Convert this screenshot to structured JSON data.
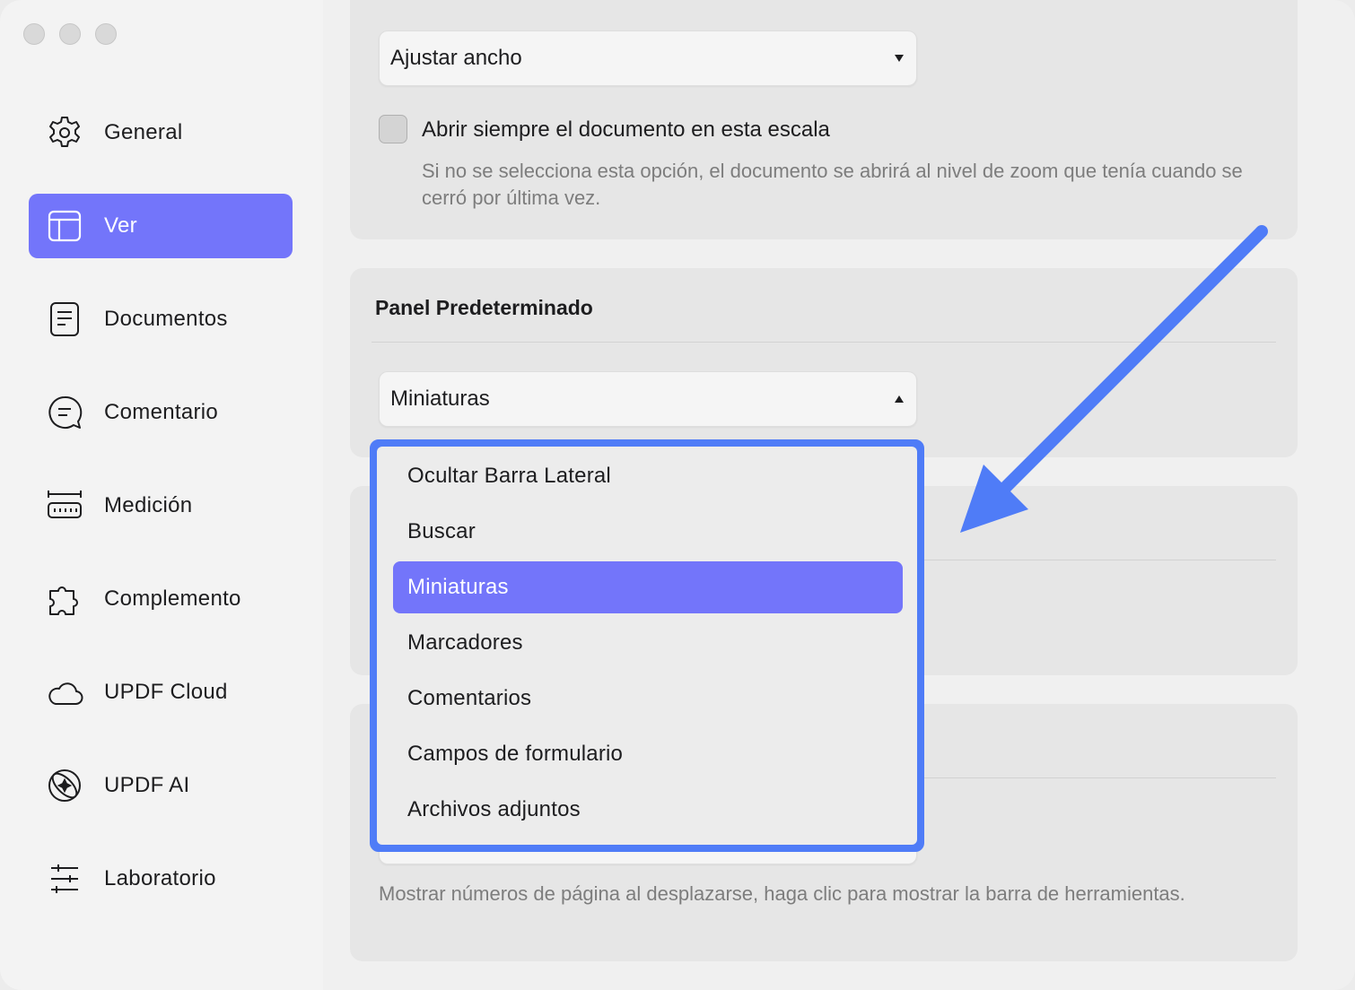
{
  "sidebar": {
    "items": [
      {
        "label": "General",
        "icon": "gear-icon"
      },
      {
        "label": "Ver",
        "icon": "layout-icon",
        "active": true
      },
      {
        "label": "Documentos",
        "icon": "document-icon"
      },
      {
        "label": "Comentario",
        "icon": "comment-icon"
      },
      {
        "label": "Medición",
        "icon": "ruler-icon"
      },
      {
        "label": "Complemento",
        "icon": "puzzle-icon"
      },
      {
        "label": "UPDF Cloud",
        "icon": "cloud-icon"
      },
      {
        "label": "UPDF AI",
        "icon": "ai-icon"
      },
      {
        "label": "Laboratorio",
        "icon": "sliders-icon"
      }
    ]
  },
  "zoom": {
    "select_value": "Ajustar ancho",
    "checkbox_label": "Abrir siempre el documento en esta escala",
    "checkbox_checked": false,
    "help_text": "Si no se selecciona esta opción, el documento se abrirá al nivel de zoom que tenía cuando se cerró por última vez."
  },
  "panel": {
    "title": "Panel Predeterminado",
    "select_value": "Miniaturas",
    "options": [
      "Ocultar Barra Lateral",
      "Buscar",
      "Miniaturas",
      "Marcadores",
      "Comentarios",
      "Campos de formulario",
      "Archivos adjuntos"
    ],
    "selected_index": 2
  },
  "bottom": {
    "help_text": "Mostrar números de página al desplazarse, haga clic para mostrar la barra de herramientas."
  },
  "colors": {
    "accent": "#7375fa",
    "annotation_blue": "#4f7cf7"
  }
}
